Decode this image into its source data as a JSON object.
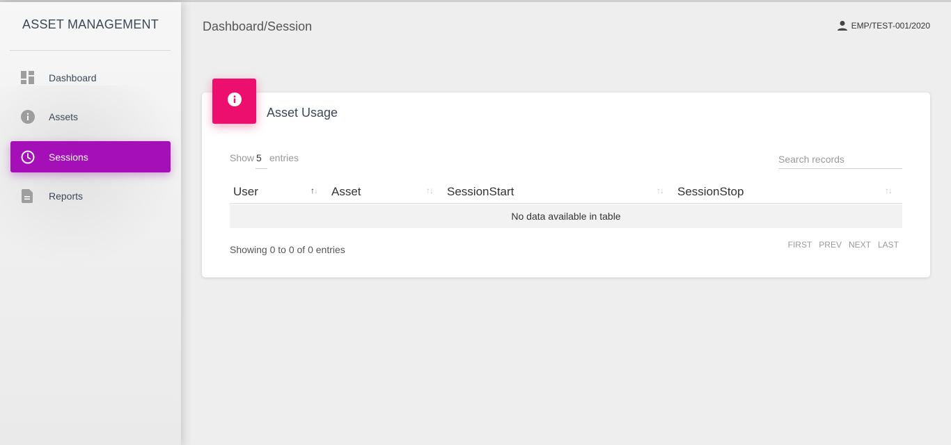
{
  "app": {
    "brand": "ASSET MANAGEMENT",
    "breadcrumb": "Dashboard/Session",
    "user": "EMP/TEST-001/2020"
  },
  "sidebar": {
    "items": [
      {
        "label": "Dashboard",
        "icon": "dashboard-icon",
        "active": false
      },
      {
        "label": "Assets",
        "icon": "info-icon",
        "active": false
      },
      {
        "label": "Sessions",
        "icon": "clock-icon",
        "active": true
      },
      {
        "label": "Reports",
        "icon": "document-icon",
        "active": false
      }
    ]
  },
  "card": {
    "icon": "info-icon",
    "title": "Asset Usage",
    "show_label": "Show",
    "show_value": "5",
    "entries_label": "entries",
    "search_placeholder": "Search records",
    "columns": [
      "User",
      "Asset",
      "SessionStart",
      "SessionStop"
    ],
    "empty_message": "No data available in table",
    "info": "Showing 0 to 0 of 0 entries",
    "pager": [
      "FIRST",
      "PREV",
      "NEXT",
      "LAST"
    ]
  },
  "colors": {
    "accent": "#a50fb8",
    "card_icon": "#ec0f6e"
  }
}
